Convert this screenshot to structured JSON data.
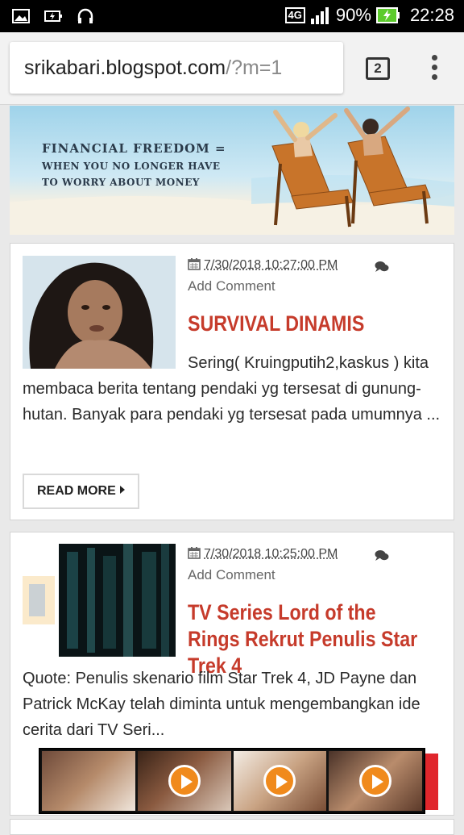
{
  "status_bar": {
    "network": "4G",
    "battery": "90%",
    "time": "22:28"
  },
  "browser": {
    "url_host": "srikabari.blogspot.com",
    "url_path": "/?m=1",
    "tab_count": "2"
  },
  "banner": {
    "line1": "FINANCIAL FREEDOM =",
    "line2": "WHEN YOU NO LONGER HAVE",
    "line3": "TO WORRY ABOUT MONEY"
  },
  "posts": [
    {
      "date": "7/30/2018 10:27:00 PM",
      "comment_link": "Add Comment",
      "title": "SURVIVAL DINAMIS",
      "excerpt_first": "Sering( Kruingputih2,kaskus )",
      "excerpt_rest": "kita membaca berita tentang pendaki yg tersesat di gunung-hutan. Banyak para pendaki yg tersesat pada umumnya ...",
      "read_more": "READ MORE"
    },
    {
      "date": "7/30/2018 10:25:00 PM",
      "comment_link": "Add Comment",
      "title": "TV Series Lord of the Rings Rekrut Penulis Star Trek 4",
      "excerpt": "Quote: Penulis skenario film Star Trek 4, JD Payne dan Patrick McKay telah diminta untuk mengembangkan ide cerita dari TV Seri..."
    }
  ],
  "ad": {
    "tiles": 4,
    "accent_color": "#e0262c"
  },
  "colors": {
    "title_red": "#c63b2b",
    "play_orange": "#f08a1c"
  }
}
